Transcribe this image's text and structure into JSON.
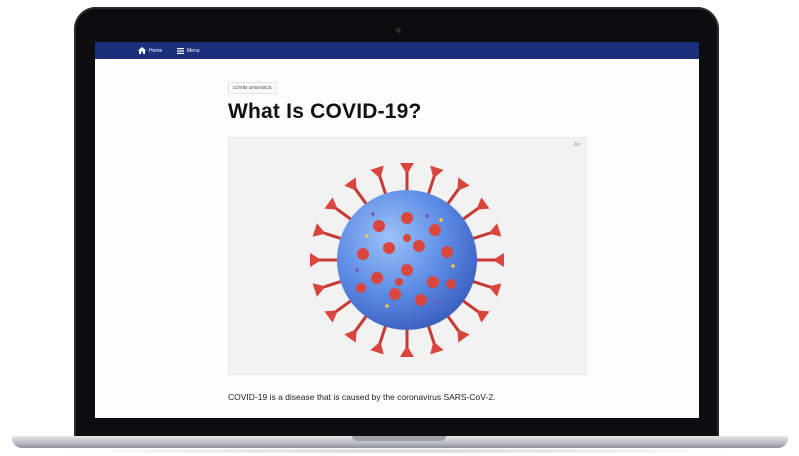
{
  "nav": {
    "home_label": "Home",
    "menu_label": "Menu"
  },
  "article": {
    "category": "COVID-19 BASICS",
    "title": "What Is COVID-19?",
    "image_badge": "Ad",
    "body": "COVID-19 is a disease that is caused by the coronavirus SARS-CoV-2."
  },
  "colors": {
    "nav": "#1b2f7c",
    "virus_body": "#5f8ee6",
    "virus_spike": "#d8463d"
  },
  "icons": [
    "home-icon",
    "menu-icon",
    "coronavirus-illustration"
  ]
}
